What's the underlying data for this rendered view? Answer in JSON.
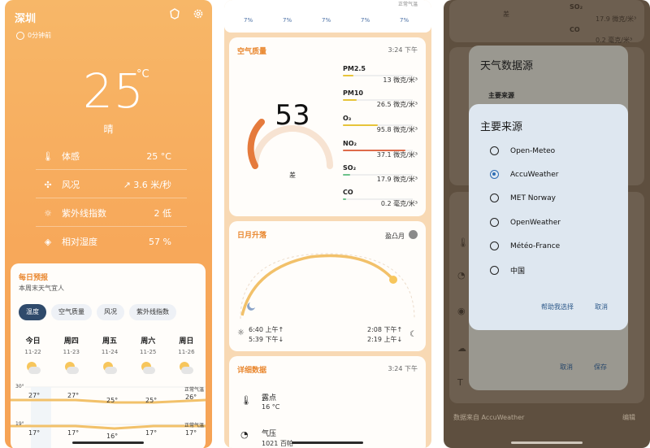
{
  "screen1": {
    "city": "深圳",
    "updated": "0分钟前",
    "temp": "25",
    "unit": "°C",
    "condition": "晴",
    "metrics": [
      {
        "label": "体感",
        "value": "25 °C",
        "icon": "thermometer-icon"
      },
      {
        "label": "风况",
        "value": "↗ 3.6 米/秒",
        "icon": "wind-icon"
      },
      {
        "label": "紫外线指数",
        "value": "2 低",
        "icon": "uv-icon"
      },
      {
        "label": "相对湿度",
        "value": "57 %",
        "icon": "humidity-icon"
      }
    ],
    "forecast": {
      "title": "每日预报",
      "subtitle": "本周末天气宜人",
      "chips": [
        "温度",
        "空气质量",
        "风况",
        "紫外线指数"
      ],
      "days": [
        {
          "name": "今日",
          "date": "11-22",
          "high": "27°",
          "low": "17°"
        },
        {
          "name": "周四",
          "date": "11-23",
          "high": "27°",
          "low": "17°"
        },
        {
          "name": "周五",
          "date": "11-24",
          "high": "25°",
          "low": "16°"
        },
        {
          "name": "周六",
          "date": "11-25",
          "high": "25°",
          "low": "17°"
        },
        {
          "name": "周日",
          "date": "11-26",
          "high": "26°",
          "low": "17°"
        }
      ],
      "axis_top": "30°",
      "axis_bottom": "19°",
      "normal_high": "正常气温",
      "normal_low": "正常气温"
    }
  },
  "screen2": {
    "precip_percents": [
      "7%",
      "7%",
      "7%",
      "7%",
      "7%"
    ],
    "top_right_note": "正常气温",
    "aqi": {
      "title": "空气质量",
      "time": "3:24 下午",
      "value": "53",
      "level": "差",
      "pollutants": [
        {
          "name": "PM2.5",
          "value": "13 微克/米³",
          "color": "#e7c43a",
          "fill": 0.15
        },
        {
          "name": "PM10",
          "value": "26.5 微克/米³",
          "color": "#e7c43a",
          "fill": 0.2
        },
        {
          "name": "O₃",
          "value": "95.8 微克/米³",
          "color": "#e7c43a",
          "fill": 0.5
        },
        {
          "name": "NO₂",
          "value": "37.1 微克/米³",
          "color": "#de6b4a",
          "fill": 0.9
        },
        {
          "name": "SO₂",
          "value": "17.9 微克/米³",
          "color": "#6cc28a",
          "fill": 0.1
        },
        {
          "name": "CO",
          "value": "0.2 毫克/米³",
          "color": "#6cc28a",
          "fill": 0.05
        }
      ]
    },
    "sun": {
      "title": "日月升落",
      "moon_phase": "盈凸月",
      "sunrise": "6:40 上午↑",
      "sunset": "5:39 下午↓",
      "moonrise": "2:08 下午↑",
      "moonset": "2:19 上午↓"
    },
    "details": {
      "title": "详细数据",
      "time": "3:24 下午",
      "dew_label": "露点",
      "dew_value": "16 °C",
      "pressure_label": "气压",
      "pressure_value": "1021 百帕"
    }
  },
  "screen3": {
    "bg_so2": "SO₂",
    "bg_so2_val": "17.9 微克/米³",
    "bg_co": "CO",
    "bg_co_val": "0.2 毫克/米³",
    "bg_level": "差",
    "back_dialog": {
      "title": "天气数据源",
      "section": "主要来源",
      "cancel": "取消",
      "save": "保存"
    },
    "dialog": {
      "title": "主要来源",
      "options": [
        "Open-Meteo",
        "AccuWeather",
        "MET Norway",
        "OpenWeather",
        "Météo-France",
        "中国"
      ],
      "selected_index": 1,
      "help": "帮助我选择",
      "cancel": "取消"
    },
    "footer_left": "数据来自 AccuWeather",
    "footer_right": "编辑"
  },
  "colors": {
    "orange_bg": "#f7a85a",
    "accent": "#e9862d",
    "chip_active": "#2f4a6b",
    "radio_selected": "#2e6db4"
  }
}
